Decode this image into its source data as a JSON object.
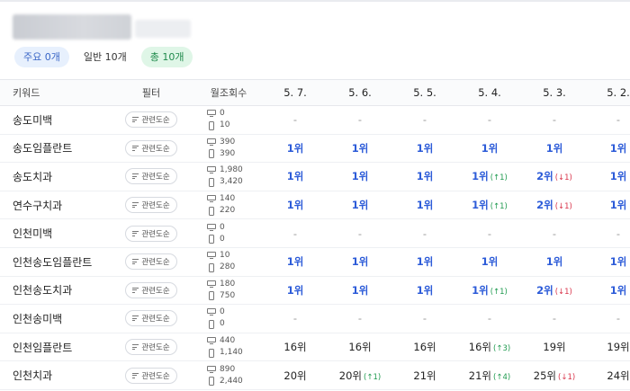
{
  "header": {
    "pills": [
      {
        "label": "주요 0개",
        "style": "blue"
      },
      {
        "label": "일반 10개",
        "style": "plain"
      },
      {
        "label": "총 10개",
        "style": "green"
      }
    ]
  },
  "table": {
    "columns": {
      "keyword": "키워드",
      "filter": "필터",
      "volume": "월조회수"
    },
    "dates": [
      "5. 7.",
      "5. 6.",
      "5. 5.",
      "5. 4.",
      "5. 3.",
      "5. 2."
    ],
    "filter_label": "관련도순",
    "rows": [
      {
        "keyword": "송도미백",
        "pc": "0",
        "mobile": "10",
        "ranks": [
          {
            "v": "-"
          },
          {
            "v": "-"
          },
          {
            "v": "-"
          },
          {
            "v": "-"
          },
          {
            "v": "-"
          },
          {
            "v": "-"
          }
        ]
      },
      {
        "keyword": "송도임플란트",
        "pc": "390",
        "mobile": "390",
        "ranks": [
          {
            "v": "1위",
            "top": true
          },
          {
            "v": "1위",
            "top": true
          },
          {
            "v": "1위",
            "top": true
          },
          {
            "v": "1위",
            "top": true
          },
          {
            "v": "1위",
            "top": true
          },
          {
            "v": "1위",
            "top": true
          }
        ]
      },
      {
        "keyword": "송도치과",
        "pc": "1,980",
        "mobile": "3,420",
        "ranks": [
          {
            "v": "1위",
            "top": true
          },
          {
            "v": "1위",
            "top": true
          },
          {
            "v": "1위",
            "top": true
          },
          {
            "v": "1위",
            "top": true,
            "chg": "(↑1)",
            "dir": "up"
          },
          {
            "v": "2위",
            "top": true,
            "chg": "(↓1)",
            "dir": "down"
          },
          {
            "v": "1위",
            "top": true
          }
        ]
      },
      {
        "keyword": "연수구치과",
        "pc": "140",
        "mobile": "220",
        "ranks": [
          {
            "v": "1위",
            "top": true
          },
          {
            "v": "1위",
            "top": true
          },
          {
            "v": "1위",
            "top": true
          },
          {
            "v": "1위",
            "top": true,
            "chg": "(↑1)",
            "dir": "up"
          },
          {
            "v": "2위",
            "top": true,
            "chg": "(↓1)",
            "dir": "down"
          },
          {
            "v": "1위",
            "top": true
          }
        ]
      },
      {
        "keyword": "인천미백",
        "pc": "0",
        "mobile": "0",
        "ranks": [
          {
            "v": "-"
          },
          {
            "v": "-"
          },
          {
            "v": "-"
          },
          {
            "v": "-"
          },
          {
            "v": "-"
          },
          {
            "v": "-"
          }
        ]
      },
      {
        "keyword": "인천송도임플란트",
        "pc": "10",
        "mobile": "280",
        "ranks": [
          {
            "v": "1위",
            "top": true
          },
          {
            "v": "1위",
            "top": true
          },
          {
            "v": "1위",
            "top": true
          },
          {
            "v": "1위",
            "top": true
          },
          {
            "v": "1위",
            "top": true
          },
          {
            "v": "1위",
            "top": true
          }
        ]
      },
      {
        "keyword": "인천송도치과",
        "pc": "180",
        "mobile": "750",
        "ranks": [
          {
            "v": "1위",
            "top": true
          },
          {
            "v": "1위",
            "top": true
          },
          {
            "v": "1위",
            "top": true
          },
          {
            "v": "1위",
            "top": true,
            "chg": "(↑1)",
            "dir": "up"
          },
          {
            "v": "2위",
            "top": true,
            "chg": "(↓1)",
            "dir": "down"
          },
          {
            "v": "1위",
            "top": true
          }
        ]
      },
      {
        "keyword": "인천송미백",
        "pc": "0",
        "mobile": "0",
        "ranks": [
          {
            "v": "-"
          },
          {
            "v": "-"
          },
          {
            "v": "-"
          },
          {
            "v": "-"
          },
          {
            "v": "-"
          },
          {
            "v": "-"
          }
        ]
      },
      {
        "keyword": "인천임플란트",
        "pc": "440",
        "mobile": "1,140",
        "ranks": [
          {
            "v": "16위"
          },
          {
            "v": "16위"
          },
          {
            "v": "16위"
          },
          {
            "v": "16위",
            "chg": "(↑3)",
            "dir": "up"
          },
          {
            "v": "19위"
          },
          {
            "v": "19위"
          }
        ]
      },
      {
        "keyword": "인천치과",
        "pc": "890",
        "mobile": "2,440",
        "ranks": [
          {
            "v": "20위"
          },
          {
            "v": "20위",
            "chg": "(↑1)",
            "dir": "up"
          },
          {
            "v": "21위"
          },
          {
            "v": "21위",
            "chg": "(↑4)",
            "dir": "up"
          },
          {
            "v": "25위",
            "chg": "(↓1)",
            "dir": "down"
          },
          {
            "v": "24위"
          }
        ]
      }
    ]
  },
  "colors": {
    "rank_top": "#2c5bd8",
    "up": "#1f9a4f",
    "down": "#d9344a"
  }
}
